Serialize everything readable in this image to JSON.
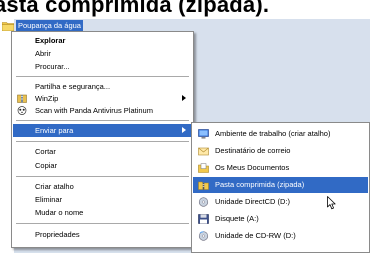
{
  "title": "asta comprimida (zipada).",
  "folder_label": "Poupança da água",
  "menu": {
    "explorar": "Explorar",
    "abrir": "Abrir",
    "procurar": "Procurar...",
    "partilha": "Partilha e segurança...",
    "winzip": "WinZip",
    "scan": "Scan with Panda Antivirus Platinum",
    "enviar_para": "Enviar para",
    "cortar": "Cortar",
    "copiar": "Copiar",
    "criar_atalho": "Criar atalho",
    "eliminar": "Eliminar",
    "mudar_nome": "Mudar o nome",
    "propriedades": "Propriedades"
  },
  "submenu": {
    "ambiente": "Ambiente de trabalho (criar atalho)",
    "correio": "Destinatário de correio",
    "documentos": "Os Meus Documentos",
    "pasta_zip": "Pasta comprimida (zipada)",
    "directcd": "Unidade DirectCD (D:)",
    "disquete": "Disquete (A:)",
    "cdrw": "Unidade de CD-RW (D:)"
  },
  "icons": {
    "folder": "folder-icon",
    "winzip": "winzip-icon",
    "scan": "panda-antivirus-icon",
    "submenu_arrow": "chevron-right-icon",
    "desktop": "desktop-icon",
    "mail": "mail-recipient-icon",
    "documents": "my-documents-icon",
    "zip": "zip-folder-icon",
    "directcd": "cd-drive-icon",
    "floppy": "floppy-drive-icon",
    "cdrw": "cd-rw-drive-icon",
    "cursor": "mouse-cursor-icon"
  },
  "colors": {
    "selection": "#316ac5",
    "menu_background": "#ffffff",
    "desktop_background": "#d7e0ed"
  }
}
